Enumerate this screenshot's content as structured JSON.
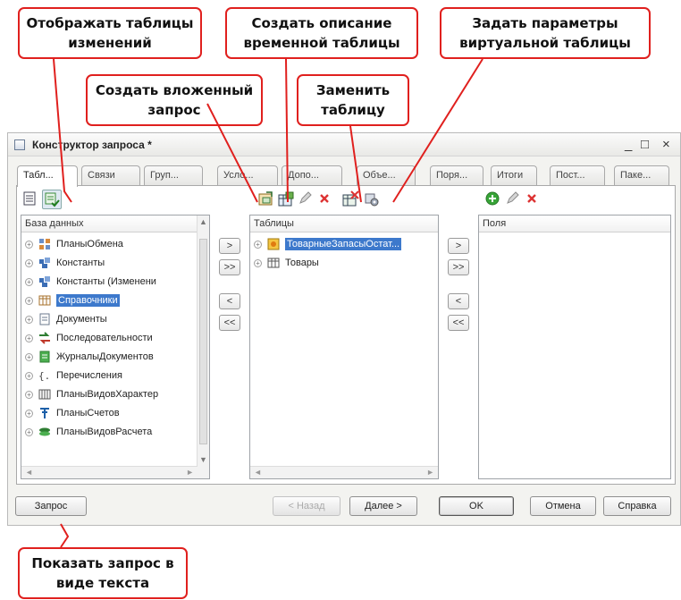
{
  "callouts": {
    "show_change_tables": "Отображать таблицы изменений",
    "create_temp_table": "Создать описание временной  таблицы",
    "virtual_table_params": "Задать параметры виртуальной таблицы",
    "create_subquery": "Создать вложенный запрос",
    "replace_table": "Заменить таблицу",
    "show_query_text": "Показать запрос в виде текста"
  },
  "window": {
    "title": "Конструктор запроса *",
    "minimize": "_",
    "maximize": "□",
    "close": "×"
  },
  "tabs": [
    "Табл...",
    "Связи",
    "Груп...",
    "Усло...",
    "Допо...",
    "Объе...",
    "Поря...",
    "Итоги",
    "Пост...",
    "Паке..."
  ],
  "db_panel": {
    "header": "База данных",
    "items": [
      {
        "label": "ПланыОбмена",
        "icon": "exchange-plans-icon"
      },
      {
        "label": "Константы",
        "icon": "constants-icon"
      },
      {
        "label": "Константы (Изменени",
        "icon": "constants-changes-icon"
      },
      {
        "label": "Справочники",
        "icon": "catalogs-icon"
      },
      {
        "label": "Документы",
        "icon": "documents-icon"
      },
      {
        "label": "Последовательности",
        "icon": "sequences-icon"
      },
      {
        "label": "ЖурналыДокументов",
        "icon": "document-journals-icon"
      },
      {
        "label": "Перечисления",
        "icon": "enumerations-icon"
      },
      {
        "label": "ПланыВидовХарактер",
        "icon": "characteristic-types-icon"
      },
      {
        "label": "ПланыСчетов",
        "icon": "chart-of-accounts-icon"
      },
      {
        "label": "ПланыВидовРасчета",
        "icon": "calculation-types-icon"
      }
    ]
  },
  "tables_panel": {
    "header": "Таблицы",
    "items": [
      {
        "label": "ТоварныеЗапасыОстат...",
        "icon": "virtual-table-icon"
      },
      {
        "label": "Товары",
        "icon": "table-icon"
      }
    ]
  },
  "fields_panel": {
    "header": "Поля"
  },
  "arrows": {
    "add": ">",
    "add_all": ">>",
    "remove": "<",
    "remove_all": "<<"
  },
  "buttons": {
    "query": "Запрос",
    "back": "< Назад",
    "next": "Далее >",
    "ok": "OK",
    "cancel": "Отмена",
    "help": "Справка"
  },
  "colors": {
    "accent": "#3d79cc",
    "callout_border": "#e0201e"
  }
}
